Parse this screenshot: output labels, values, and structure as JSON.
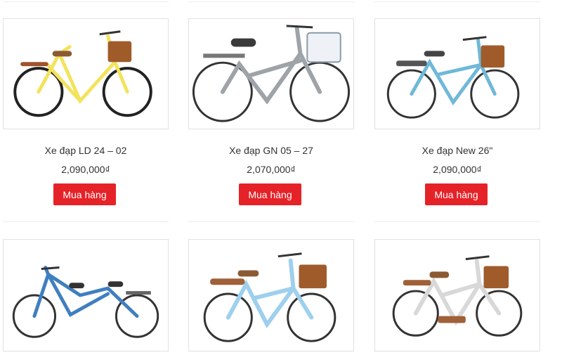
{
  "currency_symbol": "₫",
  "buy_label": "Mua hàng",
  "colors": {
    "button": "#e52228",
    "text": "#333333",
    "border": "#e1e1e1"
  },
  "products": [
    {
      "name": "Xe đạp LD 24 – 02",
      "price": "2,090,000₫",
      "frame_color": "#f2e35c",
      "icon": "bicycle-yellow-basket"
    },
    {
      "name": "Xe đạp GN 05 – 27",
      "price": "2,070,000₫",
      "frame_color": "#9ea3a8",
      "icon": "bicycle-grey-basket"
    },
    {
      "name": "Xe đạp New 26\"",
      "price": "2,090,000₫",
      "frame_color": "#6fb8d9",
      "icon": "bicycle-blue-basket"
    },
    {
      "name": "",
      "price": "",
      "frame_color": "#3f7fc0",
      "icon": "tandem-bicycle-blue"
    },
    {
      "name": "",
      "price": "",
      "frame_color": "#9ed0ee",
      "icon": "bicycle-lightblue-basket"
    },
    {
      "name": "",
      "price": "",
      "frame_color": "#f4f4f4",
      "icon": "bicycle-white-basket"
    }
  ]
}
